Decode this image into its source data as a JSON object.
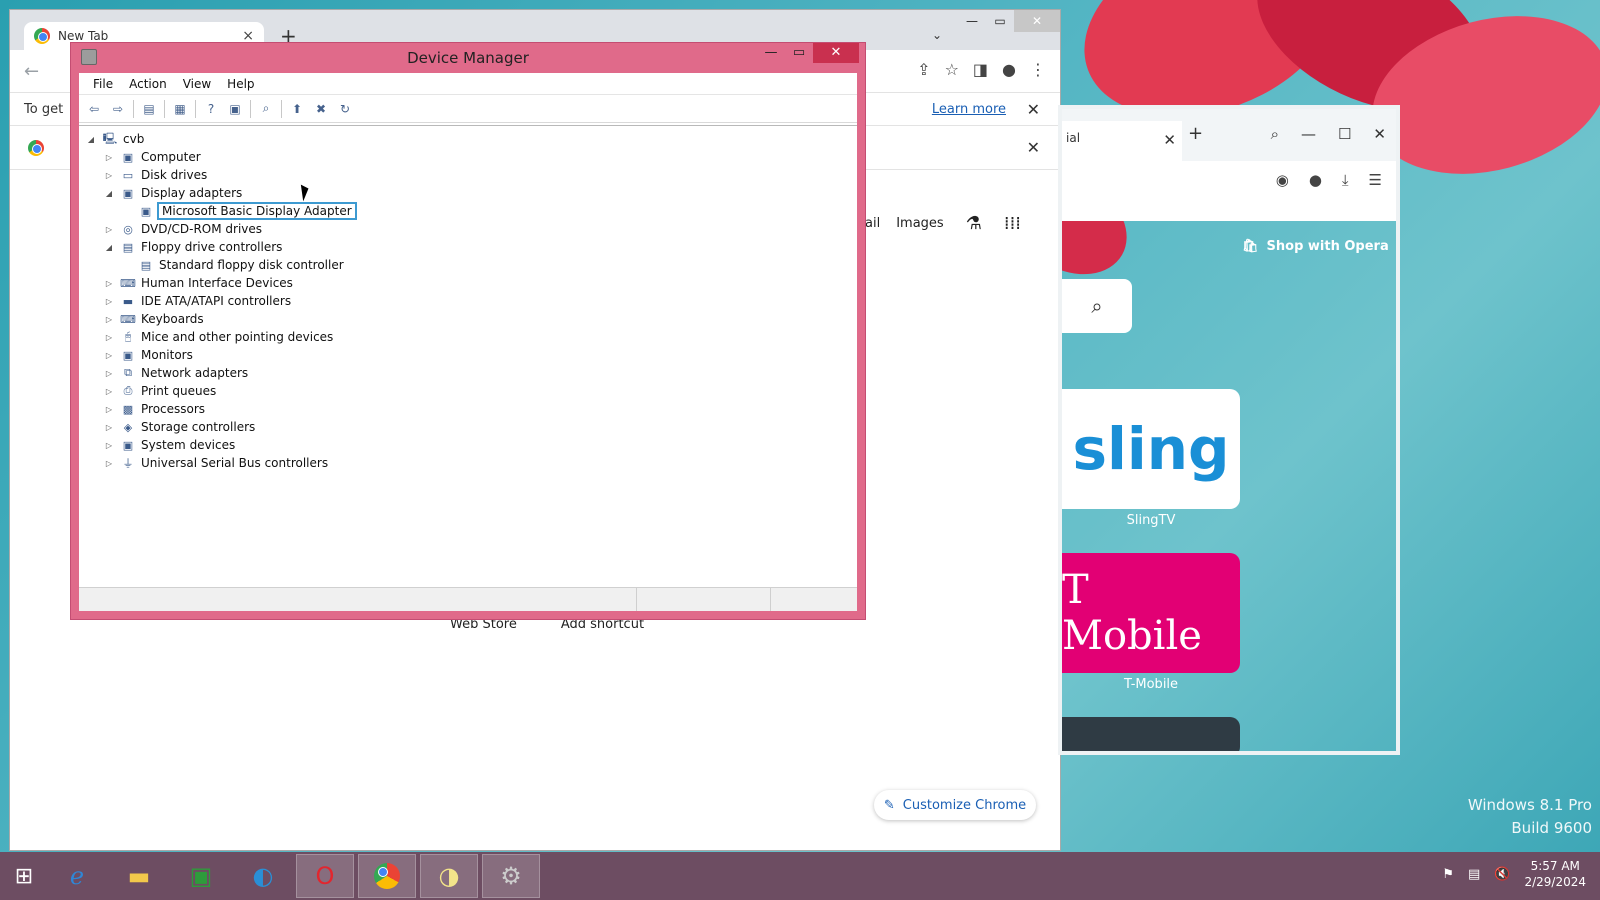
{
  "chrome": {
    "tab_title": "New Tab",
    "info_text": "To get",
    "learn_more": "Learn more",
    "links": [
      "ail",
      "Images"
    ],
    "shortcuts": [
      "Web Store",
      "Add shortcut"
    ],
    "customize": "Customize Chrome"
  },
  "opera": {
    "tab_title": "ial",
    "shop": "Shop with Opera",
    "tiles": [
      {
        "logo": "sling",
        "label": "SlingTV"
      },
      {
        "logo": "T Mobile",
        "label": "T-Mobile"
      }
    ]
  },
  "device_manager": {
    "title": "Device Manager",
    "menu": [
      "File",
      "Action",
      "View",
      "Help"
    ],
    "root": "cvb",
    "nodes": [
      {
        "label": "Computer",
        "expanded": false,
        "level": 1,
        "icon": "computer-icon"
      },
      {
        "label": "Disk drives",
        "expanded": false,
        "level": 1,
        "icon": "disk-icon"
      },
      {
        "label": "Display adapters",
        "expanded": true,
        "level": 1,
        "icon": "display-icon"
      },
      {
        "label": "Microsoft Basic Display Adapter",
        "level": 2,
        "selected": true,
        "icon": "display-adapter-icon"
      },
      {
        "label": "DVD/CD-ROM drives",
        "expanded": false,
        "level": 1,
        "icon": "dvd-icon"
      },
      {
        "label": "Floppy drive controllers",
        "expanded": true,
        "level": 1,
        "icon": "floppy-icon"
      },
      {
        "label": "Standard floppy disk controller",
        "level": 2,
        "icon": "floppy-controller-icon"
      },
      {
        "label": "Human Interface Devices",
        "expanded": false,
        "level": 1,
        "icon": "hid-icon"
      },
      {
        "label": "IDE ATA/ATAPI controllers",
        "expanded": false,
        "level": 1,
        "icon": "ide-icon"
      },
      {
        "label": "Keyboards",
        "expanded": false,
        "level": 1,
        "icon": "keyboard-icon"
      },
      {
        "label": "Mice and other pointing devices",
        "expanded": false,
        "level": 1,
        "icon": "mouse-icon"
      },
      {
        "label": "Monitors",
        "expanded": false,
        "level": 1,
        "icon": "monitor-icon"
      },
      {
        "label": "Network adapters",
        "expanded": false,
        "level": 1,
        "icon": "network-icon"
      },
      {
        "label": "Print queues",
        "expanded": false,
        "level": 1,
        "icon": "printer-icon"
      },
      {
        "label": "Processors",
        "expanded": false,
        "level": 1,
        "icon": "cpu-icon"
      },
      {
        "label": "Storage controllers",
        "expanded": false,
        "level": 1,
        "icon": "storage-icon"
      },
      {
        "label": "System devices",
        "expanded": false,
        "level": 1,
        "icon": "system-icon"
      },
      {
        "label": "Universal Serial Bus controllers",
        "expanded": false,
        "level": 1,
        "icon": "usb-icon"
      }
    ]
  },
  "desktop": {
    "watermark_line1": "Windows 8.1 Pro",
    "watermark_line2": "Build 9600"
  },
  "taskbar": {
    "time": "5:57 AM",
    "date": "2/29/2024"
  },
  "colors": {
    "dm_frame": "#e06a8a",
    "taskbar": "#6d4d62",
    "selection": "#3d9ad1",
    "tmobile": "#e20074"
  }
}
